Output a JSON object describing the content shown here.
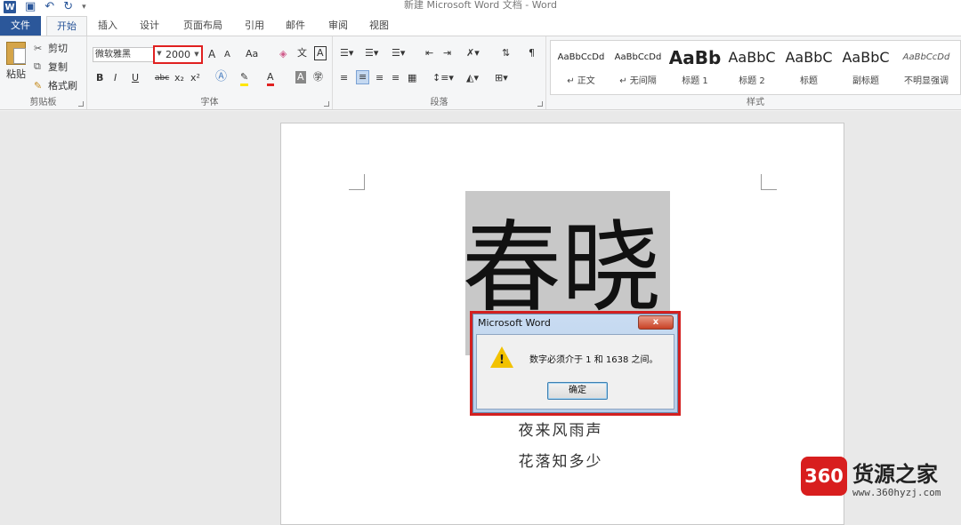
{
  "window": {
    "title": "新建 Microsoft Word 文档 - Word",
    "app_icon_letter": "W"
  },
  "quick_access": {
    "save_icon": "save-icon",
    "undo_icon": "undo-icon",
    "redo_icon": "redo-icon",
    "customize": "▾"
  },
  "tabs": [
    {
      "label": "文件"
    },
    {
      "label": "开始"
    },
    {
      "label": "插入"
    },
    {
      "label": "设计"
    },
    {
      "label": "页面布局"
    },
    {
      "label": "引用"
    },
    {
      "label": "邮件"
    },
    {
      "label": "审阅"
    },
    {
      "label": "视图"
    }
  ],
  "clipboard": {
    "paste_label": "粘贴",
    "cut_label": "剪切",
    "copy_label": "复制",
    "format_painter_label": "格式刷",
    "group_label": "剪贴板"
  },
  "font": {
    "font_name": "微软雅黑",
    "font_size": "2000",
    "group_label": "字体",
    "grow": "A",
    "shrink": "A",
    "case": "Aa",
    "bold": "B",
    "italic": "I",
    "underline": "U",
    "strike": "abc",
    "sub": "x₂",
    "sup": "x²"
  },
  "paragraph": {
    "group_label": "段落"
  },
  "styles": {
    "group_label": "样式",
    "items": [
      {
        "sample": "AaBbCcDd",
        "name": "↵ 正文"
      },
      {
        "sample": "AaBbCcDd",
        "name": "↵ 无间隔"
      },
      {
        "sample": "AaBb",
        "name": "标题 1"
      },
      {
        "sample": "AaBbC",
        "name": "标题 2"
      },
      {
        "sample": "AaBbC",
        "name": "标题"
      },
      {
        "sample": "AaBbC",
        "name": "副标题"
      },
      {
        "sample": "AaBbCcDd",
        "name": "不明显强调"
      }
    ]
  },
  "document": {
    "heading_text": "春晓",
    "lines": [
      "夜来风雨声",
      "花落知多少"
    ]
  },
  "dialog": {
    "title": "Microsoft Word",
    "close_label": "x",
    "message": "数字必须介于 1 和 1638 之间。",
    "ok_label": "确定"
  },
  "watermark": {
    "logo_text": "360",
    "name": "货源之家",
    "url": "www.360hyzj.com"
  },
  "colors": {
    "accent": "#2b579a",
    "highlight_red": "#e02020"
  }
}
